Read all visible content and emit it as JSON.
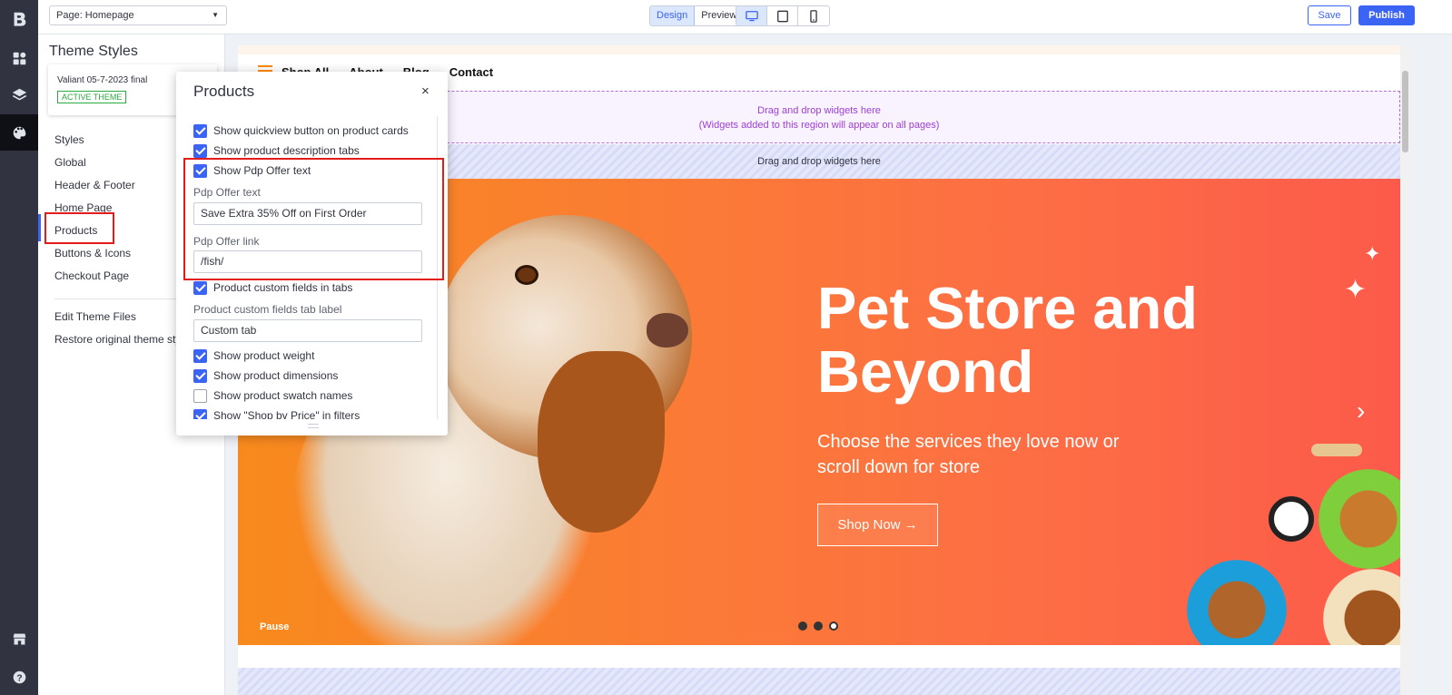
{
  "topbar": {
    "page_select": "Page: Homepage",
    "mode_design": "Design",
    "mode_preview": "Preview",
    "save_label": "Save",
    "publish_label": "Publish"
  },
  "rail": {
    "icons": [
      "bigcommerce-logo-icon",
      "dashboard-icon",
      "layers-icon",
      "palette-icon",
      "storefront-icon",
      "help-icon"
    ]
  },
  "sidebar": {
    "title": "Theme Styles",
    "theme_name": "Valiant 05-7-2023 final",
    "theme_badge": "ACTIVE THEME",
    "items": [
      {
        "label": "Styles"
      },
      {
        "label": "Global"
      },
      {
        "label": "Header & Footer"
      },
      {
        "label": "Home Page"
      },
      {
        "label": "Products"
      },
      {
        "label": "Buttons & Icons"
      },
      {
        "label": "Checkout Page"
      }
    ],
    "bottom_items": [
      {
        "label": "Edit Theme Files"
      },
      {
        "label": "Restore original theme sty"
      }
    ]
  },
  "products_panel": {
    "title": "Products",
    "close": "×",
    "checks": [
      {
        "label": "Show quickview button on product cards",
        "checked": true
      },
      {
        "label": "Show product description tabs",
        "checked": true
      },
      {
        "label": "Show Pdp Offer text",
        "checked": true
      }
    ],
    "offer_text_label": "Pdp Offer text",
    "offer_text_value": "Save Extra 35% Off on First Order",
    "offer_link_label": "Pdp Offer link",
    "offer_link_value": "/fish/",
    "custom_fields_check": {
      "label": "Product custom fields in tabs",
      "checked": true
    },
    "custom_tab_label": "Product custom fields tab label",
    "custom_tab_value": "Custom tab",
    "more_checks": [
      {
        "label": "Show product weight",
        "checked": true
      },
      {
        "label": "Show product dimensions",
        "checked": true
      },
      {
        "label": "Show product swatch names",
        "checked": false
      },
      {
        "label": "Show \"Shop by Price\" in filters",
        "checked": true
      }
    ]
  },
  "preview": {
    "nav_links": [
      "Shop All",
      "About",
      "Blog",
      "Contact"
    ],
    "drop_zone_global_line1": "Drag and drop widgets here",
    "drop_zone_global_line2": "(Widgets added to this region will appear on all pages)",
    "drop_zone_page": "Drag and drop widgets here",
    "hero_title": "Pet Store and Beyond",
    "hero_subtitle": "Choose the services they love now or scroll down for store",
    "hero_button": "Shop Now →",
    "pause_label": "Pause",
    "slide_count": 3,
    "current_slide": 3
  },
  "colors": {
    "accent": "#3c64f4",
    "rail_bg": "#313440",
    "highlight": "#e31b1b",
    "hero_orange": "#fb7a37",
    "active_green": "#2aab3f"
  }
}
